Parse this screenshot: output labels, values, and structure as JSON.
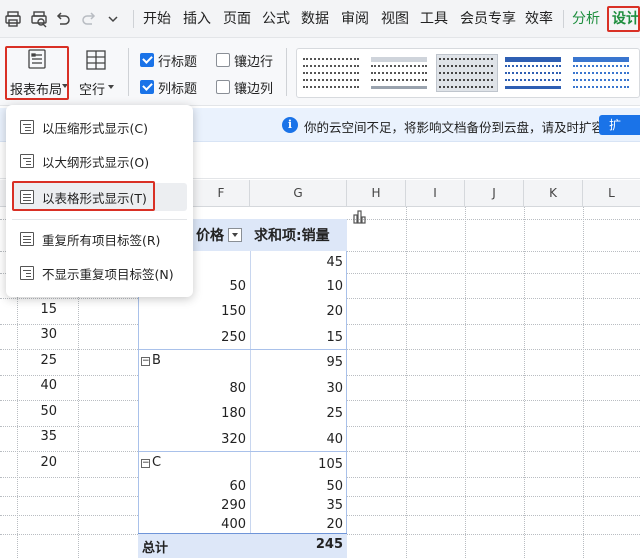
{
  "menubar": {
    "tabs": [
      "开始",
      "插入",
      "页面",
      "公式",
      "数据",
      "审阅",
      "视图",
      "工具",
      "会员专享",
      "效率"
    ],
    "analyze": "分析",
    "design": "设计"
  },
  "ribbon": {
    "report_layout": "报表布局",
    "blank_rows": "空行",
    "checkboxes": [
      {
        "label": "行标题",
        "checked": true
      },
      {
        "label": "镶边行",
        "checked": false
      },
      {
        "label": "列标题",
        "checked": true
      },
      {
        "label": "镶边列",
        "checked": false
      }
    ]
  },
  "notify": {
    "message": "你的云空间不足，将影响文档备份到云盘，请及时扩容",
    "button": "扩"
  },
  "dropdown": {
    "items": [
      "以压缩形式显示(C)",
      "以大纲形式显示(O)",
      "以表格形式显示(T)",
      "重复所有项目标签(R)",
      "不显示重复项目标签(N)"
    ]
  },
  "grid": {
    "column_headers": [
      "F",
      "G",
      "H",
      "I",
      "J",
      "K",
      "L"
    ],
    "pivot_headers": {
      "price": "价格",
      "sum": "求和项:销量"
    },
    "left_col_values": [
      "15",
      "30",
      "25",
      "40",
      "50",
      "35",
      "20"
    ],
    "rows": [
      {
        "price": "",
        "sum": "45"
      },
      {
        "price": "50",
        "sum": "10"
      },
      {
        "price": "150",
        "sum": "20"
      },
      {
        "price": "250",
        "sum": "15"
      },
      {
        "price": "B",
        "sum": "95",
        "group": true
      },
      {
        "price": "80",
        "sum": "30"
      },
      {
        "price": "180",
        "sum": "25"
      },
      {
        "price": "320",
        "sum": "40"
      },
      {
        "price": "C",
        "sum": "105",
        "group": true
      },
      {
        "price": "60",
        "sum": "50"
      },
      {
        "price": "290",
        "sum": "35"
      },
      {
        "price": "400",
        "sum": "20"
      }
    ],
    "total_label": "总计",
    "total_value": "245"
  },
  "colors": {
    "accent": "#1a73e8",
    "design_green": "#1e8e3e",
    "highlight_red": "#d93025",
    "pivot_header": "#dde7f8"
  }
}
